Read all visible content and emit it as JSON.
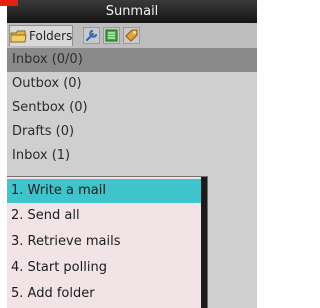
{
  "app": {
    "title": "Sunmail"
  },
  "toolbar": {
    "folders_tab_label": "Folders",
    "icons": [
      "folder-icon",
      "wrench-icon",
      "list-icon",
      "tag-icon"
    ]
  },
  "folders": [
    {
      "label": "Inbox (0/0)",
      "selected": true
    },
    {
      "label": "Outbox (0)"
    },
    {
      "label": "Sentbox (0)"
    },
    {
      "label": "Drafts (0)"
    },
    {
      "label": "Inbox (1)"
    }
  ],
  "menu": {
    "items": [
      {
        "label": "1. Write a mail",
        "highlighted": true
      },
      {
        "label": "2. Send all"
      },
      {
        "label": "3. Retrieve mails"
      },
      {
        "label": "4. Start polling"
      },
      {
        "label": "5. Add folder"
      }
    ]
  },
  "colors": {
    "highlight": "#3fc4cc",
    "menu_bg": "#f1e3e6",
    "title_bg": "#1e1e1e"
  }
}
